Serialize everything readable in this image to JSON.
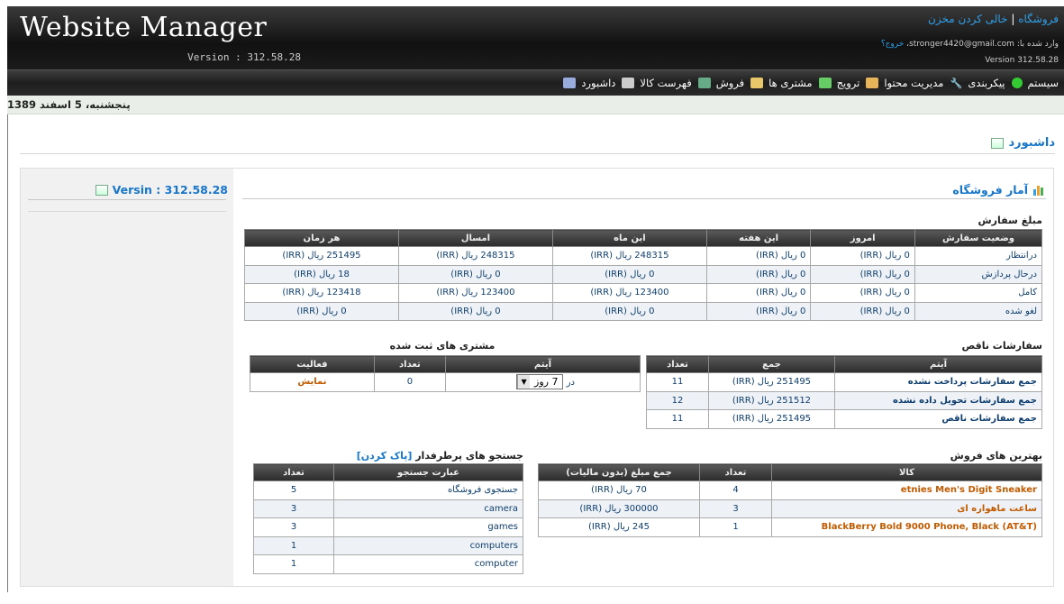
{
  "header": {
    "logo": "Website Manager",
    "version": "Version : 312.58.28",
    "link_store": "فروشگاه",
    "separator": "|",
    "link_empty_cart": "خالی کردن مخزن",
    "login_prefix": "وارد شده با: stronger4420@gmail.com، ",
    "logout": "خروج؟",
    "version_small": "Version 312.58.28"
  },
  "menu": [
    {
      "label": "داشبورد",
      "icon": "dashboard-icon"
    },
    {
      "label": "فهرست کالا",
      "icon": "list-icon"
    },
    {
      "label": "فروش",
      "icon": "sales-chart-icon"
    },
    {
      "label": "مشتری ها",
      "icon": "customers-icon"
    },
    {
      "label": "ترویج",
      "icon": "tag-icon"
    },
    {
      "label": "مدیریت محتوا",
      "icon": "folder-icon"
    },
    {
      "label": "پیکربندی",
      "icon": "wrench-icon"
    },
    {
      "label": "سیستم",
      "icon": "green-dot-icon"
    }
  ],
  "date": "پنجشنبه، 5 اسفند 1389",
  "page_title": "داشبورد",
  "sidebar": {
    "version": "Versin : 312.58.28"
  },
  "stats": {
    "title": "آمار فروشگاه",
    "order_amount_title": "مبلغ سفارش",
    "order_headers": [
      "وضعیت سفارش",
      "امروز",
      "این هفته",
      "این ماه",
      "امسال",
      "هر زمان"
    ],
    "order_rows": [
      [
        "درانتظار",
        "0 ریال (IRR)",
        "0 ریال (IRR)",
        "248315 ریال (IRR)",
        "248315 ریال (IRR)",
        "251495 ریال (IRR)"
      ],
      [
        "درحال پردازش",
        "0 ریال (IRR)",
        "0 ریال (IRR)",
        "0 ریال (IRR)",
        "0 ریال (IRR)",
        "18 ریال (IRR)"
      ],
      [
        "کامل",
        "0 ریال (IRR)",
        "0 ریال (IRR)",
        "123400 ریال (IRR)",
        "123400 ریال (IRR)",
        "123418 ریال (IRR)"
      ],
      [
        "لغو شده",
        "0 ریال (IRR)",
        "0 ریال (IRR)",
        "0 ریال (IRR)",
        "0 ریال (IRR)",
        "0 ریال (IRR)"
      ]
    ],
    "incomplete_title": "سفارشات ناقص",
    "incomplete_headers": [
      "آیتم",
      "جمع",
      "تعداد"
    ],
    "incomplete_rows": [
      [
        "جمع سفارشات پرداخت نشده",
        "251495 ریال (IRR)",
        "11"
      ],
      [
        "جمع سفارشات تحویل داده نشده",
        "251512 ریال (IRR)",
        "12"
      ],
      [
        "جمع سفارشات ناقص",
        "251495 ریال (IRR)",
        "11"
      ]
    ],
    "registered_title": "مشتری های ثبت شده",
    "registered_headers": [
      "آیتم",
      "تعداد",
      "فعالیت"
    ],
    "registered_prefix": "در",
    "registered_select": "7 روز",
    "registered_count": "0",
    "registered_action": "نمایش",
    "best_title": "بهترین های فروش",
    "best_headers": [
      "کالا",
      "تعداد",
      "جمع مبلغ (بدون مالیات)"
    ],
    "best_rows": [
      [
        "etnies Men's Digit Sneaker",
        "4",
        "70 ریال (IRR)"
      ],
      [
        "ساعت ماهواره ای",
        "3",
        "300000 ریال (IRR)"
      ],
      [
        "BlackBerry Bold 9000 Phone, Black (AT&T)",
        "1",
        "245 ریال (IRR)"
      ]
    ],
    "search_title": "جستجو های پرطرفدار",
    "search_clear": "[پاک کردن]",
    "search_headers": [
      "عبارت جستجو",
      "تعداد"
    ],
    "search_rows": [
      [
        "جستجوی فروشگاه",
        "5"
      ],
      [
        "camera",
        "3"
      ],
      [
        "games",
        "3"
      ],
      [
        "computers",
        "1"
      ],
      [
        "computer",
        "1"
      ]
    ]
  }
}
